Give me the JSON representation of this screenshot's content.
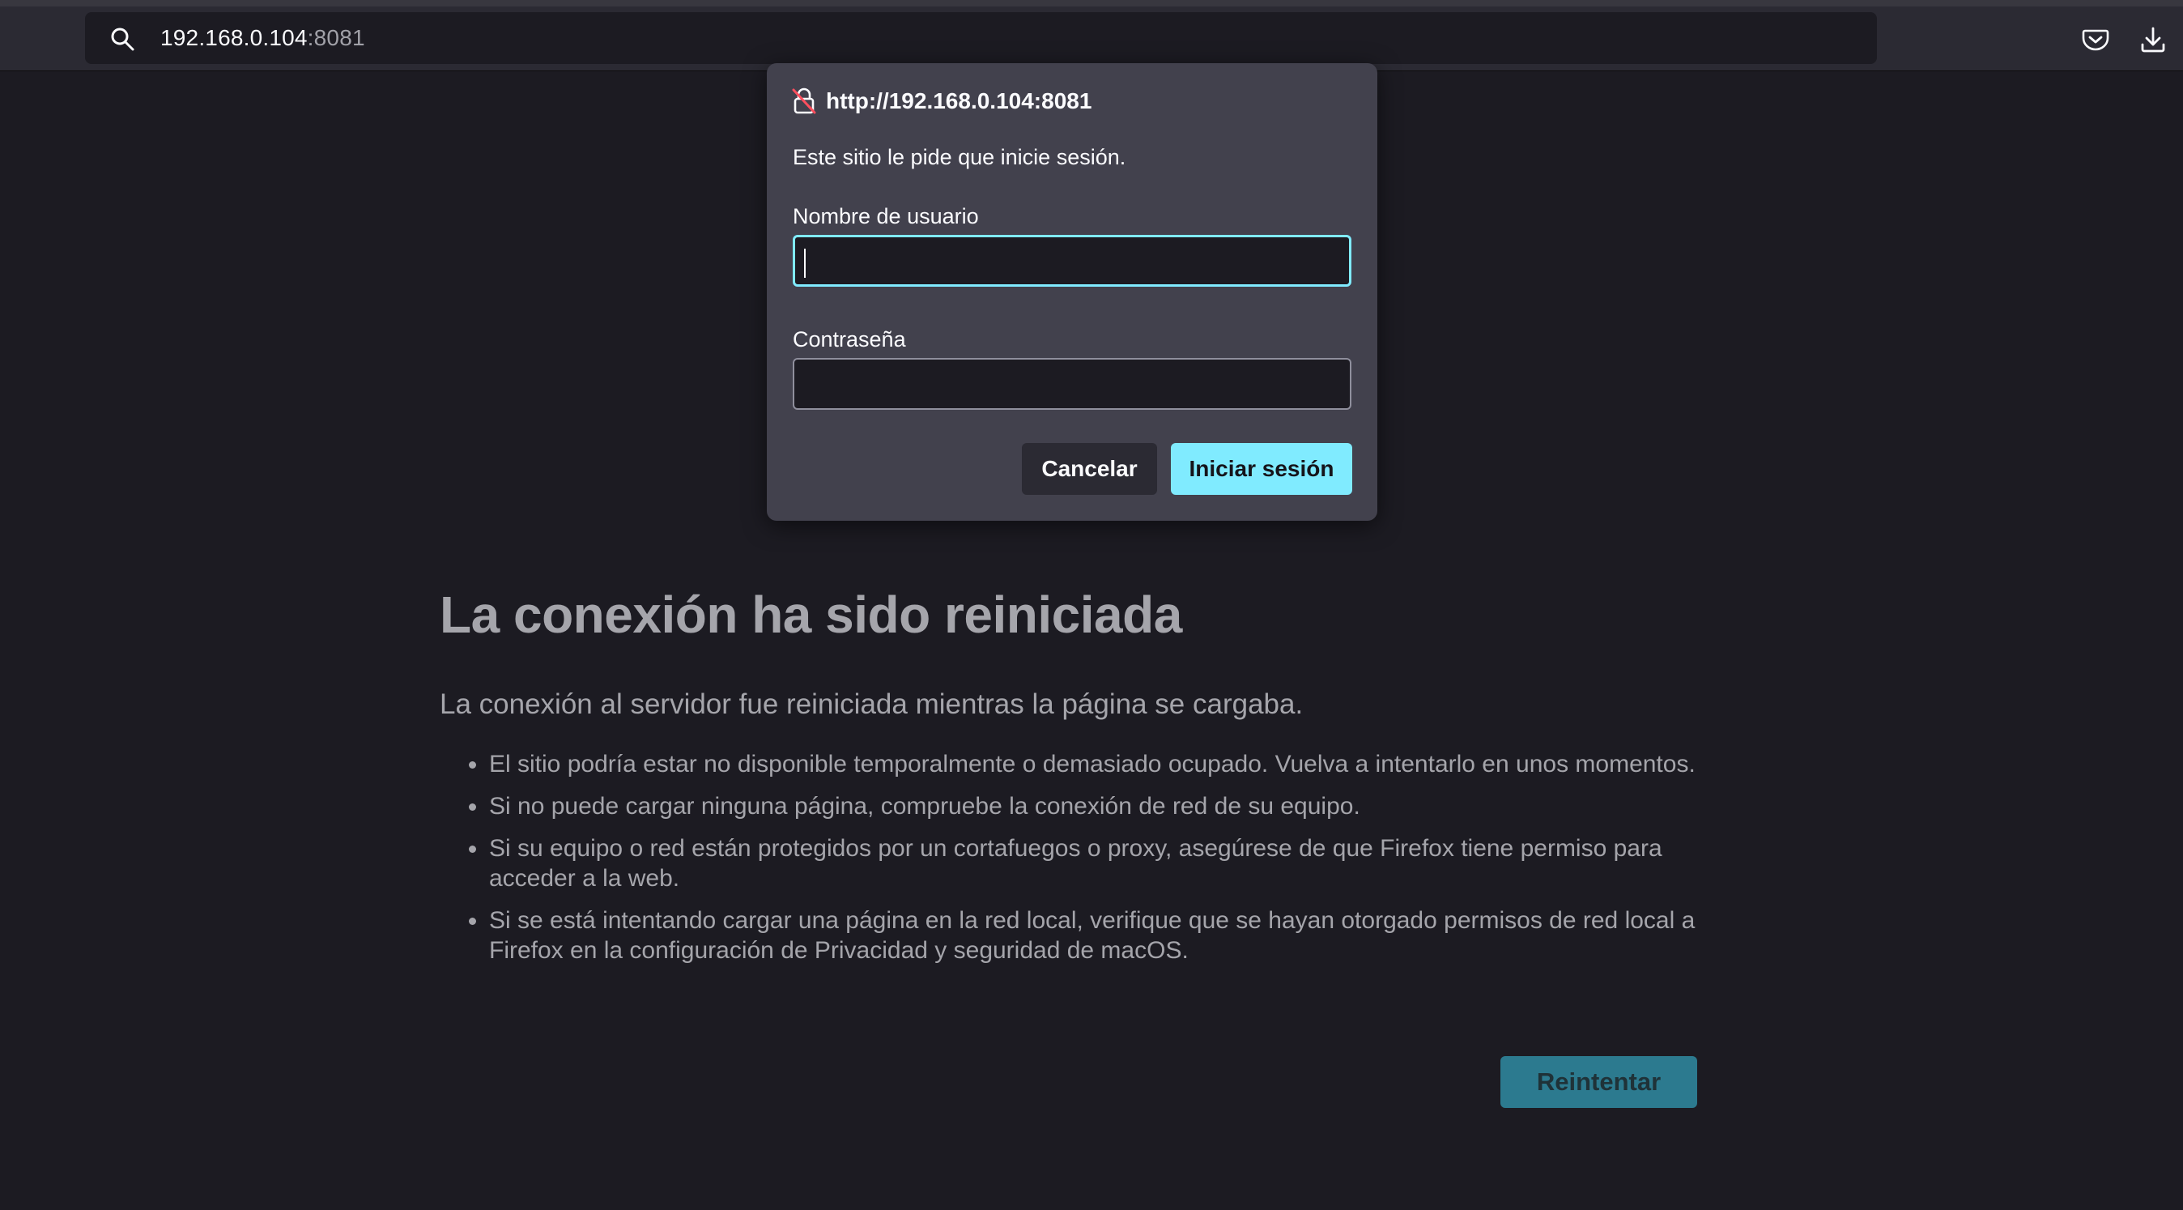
{
  "toolbar": {
    "url_host": "192.168.0.104",
    "url_port": ":8081",
    "search_icon": "search-icon",
    "pocket_icon": "pocket-icon",
    "downloads_icon": "download-icon"
  },
  "dialog": {
    "origin": "http://192.168.0.104:8081",
    "lock_icon": "insecure-lock-icon",
    "message": "Este sitio le pide que inicie sesión.",
    "username_label": "Nombre de usuario",
    "username_value": "",
    "password_label": "Contraseña",
    "password_value": "",
    "cancel_label": "Cancelar",
    "login_label": "Iniciar sesión"
  },
  "error": {
    "title": "La conexión ha sido reiniciada",
    "description": "La conexión al servidor fue reiniciada mientras la página se cargaba.",
    "items": [
      "El sitio podría estar no disponible temporalmente o demasiado ocupado. Vuelva a intentarlo en unos momentos.",
      "Si no puede cargar ninguna página, compruebe la conexión de red de su equipo.",
      "Si su equipo o red están protegidos por un cortafuegos o proxy, asegúrese de que Firefox tiene permiso para acceder a la web.",
      "Si se está intentando cargar una página en la red local, verifique que se hayan otorgado permisos de red local a Firefox en la configuración de Privacidad y seguridad de macOS."
    ],
    "retry_label": "Reintentar"
  },
  "colors": {
    "accent": "#80ebff",
    "page_bg": "#1c1b22",
    "dialog_bg": "#42414d",
    "retry_bg": "#2c7a8f"
  }
}
